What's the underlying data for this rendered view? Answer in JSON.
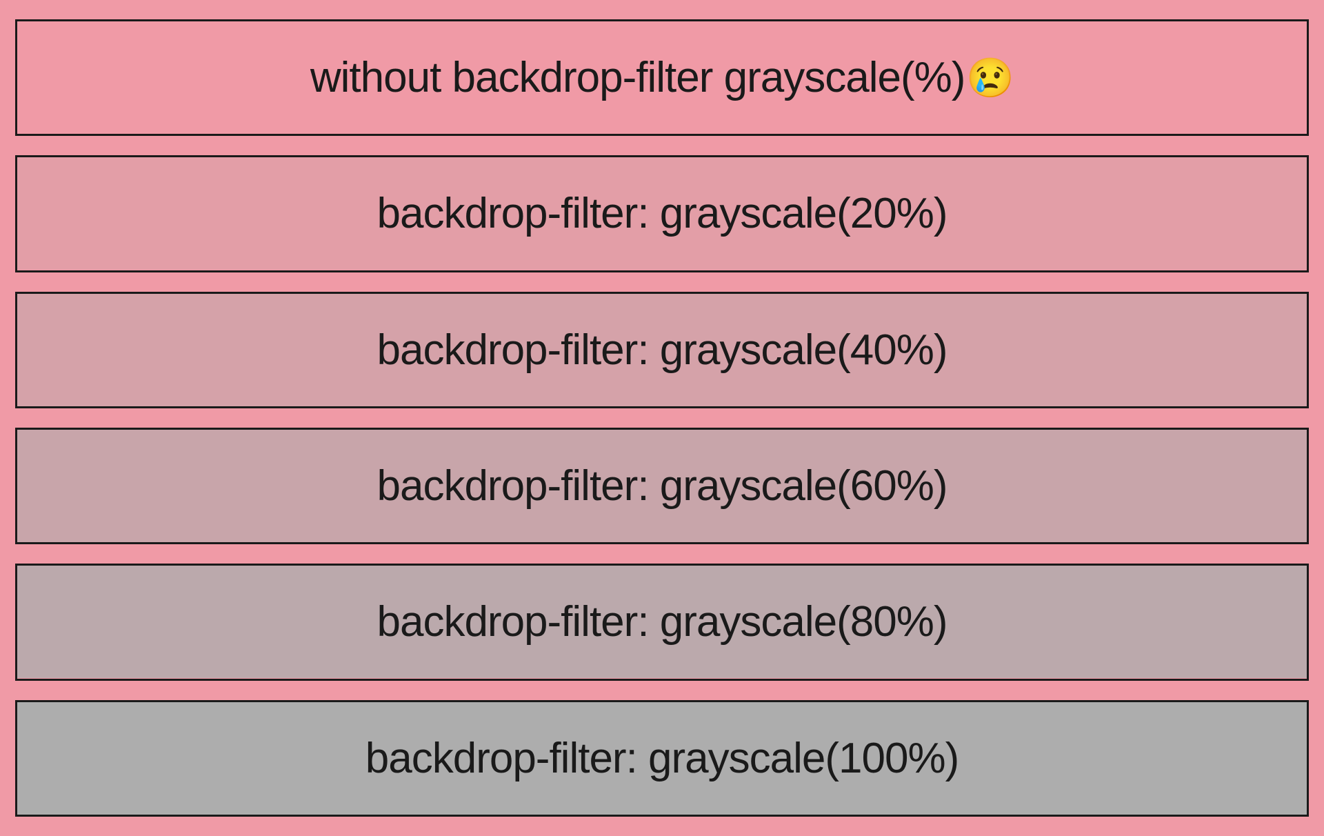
{
  "rows": [
    {
      "label": "without backdrop-filter grayscale(%)",
      "emoji": "😢",
      "grayscale_pct": 0
    },
    {
      "label": "backdrop-filter: grayscale(20%)",
      "emoji": "",
      "grayscale_pct": 20
    },
    {
      "label": "backdrop-filter: grayscale(40%)",
      "emoji": "",
      "grayscale_pct": 40
    },
    {
      "label": "backdrop-filter: grayscale(60%)",
      "emoji": "",
      "grayscale_pct": 60
    },
    {
      "label": "backdrop-filter: grayscale(80%)",
      "emoji": "",
      "grayscale_pct": 80
    },
    {
      "label": "backdrop-filter: grayscale(100%)",
      "emoji": "",
      "grayscale_pct": 100
    }
  ],
  "colors": {
    "background": "#f09aa6",
    "border": "#1a1a1a",
    "text": "#1a1a1a"
  }
}
